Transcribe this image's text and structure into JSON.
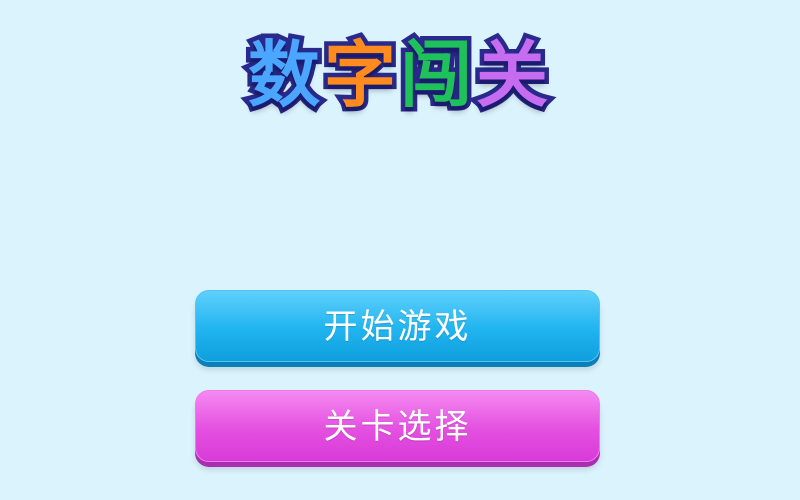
{
  "title": {
    "chars": [
      "数",
      "字",
      "闯",
      "关"
    ],
    "colors": [
      "#4aa6ff",
      "#ff8a1e",
      "#1fc25a",
      "#c56cf0"
    ]
  },
  "menu": {
    "start_label": "开始游戏",
    "level_select_label": "关卡选择"
  },
  "colors": {
    "background": "#dbf3fd",
    "start_button": "#20b4f0",
    "level_button": "#e450e0"
  }
}
